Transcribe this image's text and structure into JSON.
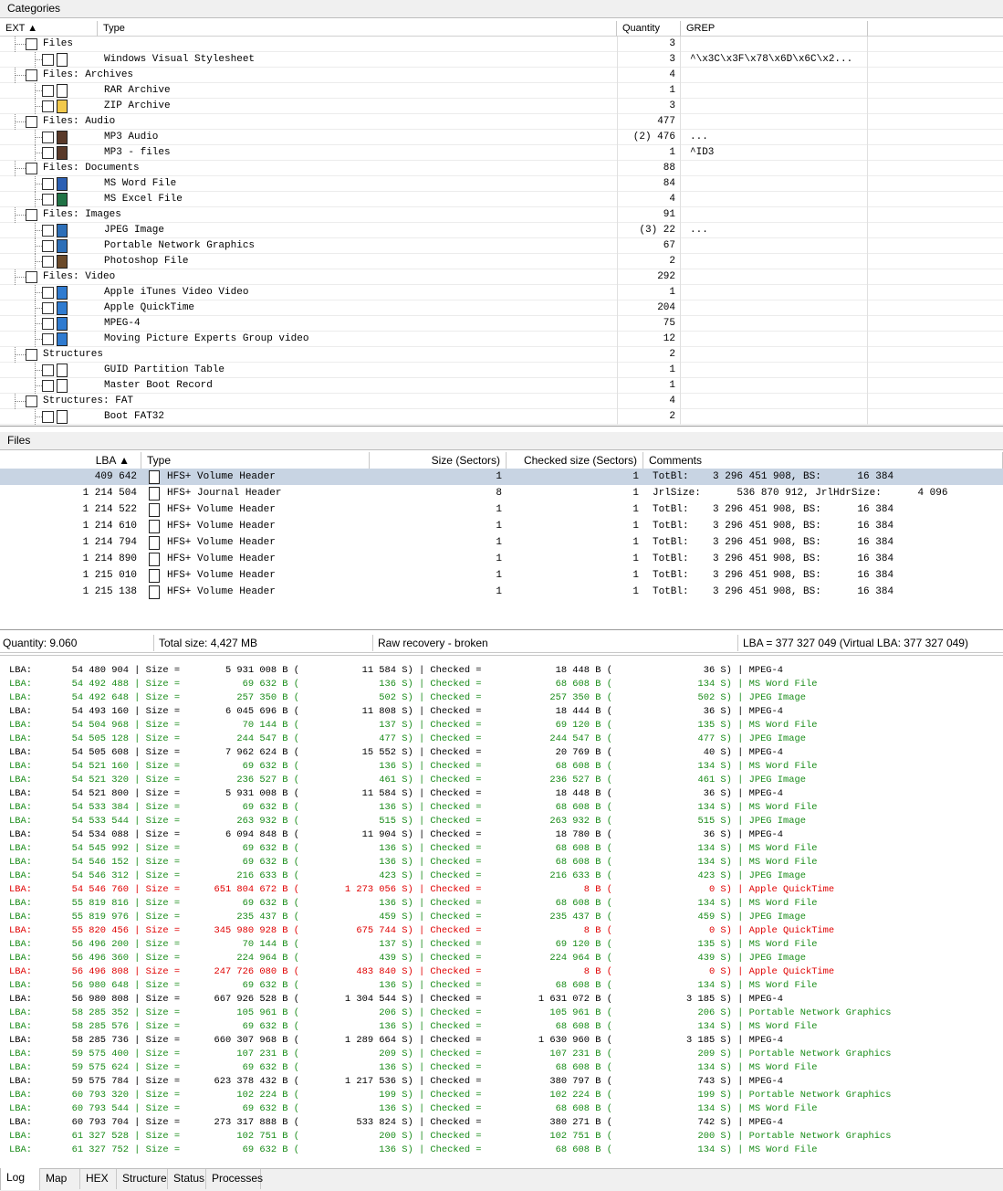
{
  "categories": {
    "title": "Categories",
    "columns": {
      "ext": "EXT",
      "type": "Type",
      "quantity": "Quantity",
      "grep": "GREP"
    },
    "rows": [
      {
        "level": 0,
        "label": "Files",
        "qty": "3",
        "grep": ""
      },
      {
        "level": 1,
        "label": "Windows Visual Stylesheet",
        "qty": "3",
        "grep": "^\\x3C\\x3F\\x78\\x6D\\x6C\\x2...",
        "icon": "blank-file-icon"
      },
      {
        "level": 0,
        "label": "Files: Archives",
        "qty": "4",
        "grep": ""
      },
      {
        "level": 1,
        "label": "RAR Archive",
        "qty": "1",
        "grep": "",
        "icon": "blank-file-icon"
      },
      {
        "level": 1,
        "label": "ZIP Archive",
        "qty": "3",
        "grep": "",
        "icon": "zip-file-icon"
      },
      {
        "level": 0,
        "label": "Files: Audio",
        "qty": "477",
        "grep": ""
      },
      {
        "level": 1,
        "label": "MP3 Audio",
        "qty": "(2) 476",
        "grep": "...",
        "icon": "audio-file-icon"
      },
      {
        "level": 1,
        "label": "MP3 - files",
        "qty": "1",
        "grep": "^ID3",
        "icon": "audio-file-icon"
      },
      {
        "level": 0,
        "label": "Files: Documents",
        "qty": "88",
        "grep": ""
      },
      {
        "level": 1,
        "label": "MS Word File",
        "qty": "84",
        "grep": "",
        "icon": "word-file-icon"
      },
      {
        "level": 1,
        "label": "MS Excel File",
        "qty": "4",
        "grep": "",
        "icon": "excel-file-icon"
      },
      {
        "level": 0,
        "label": "Files: Images",
        "qty": "91",
        "grep": ""
      },
      {
        "level": 1,
        "label": "JPEG Image",
        "qty": "(3) 22",
        "grep": "...",
        "icon": "image-file-icon"
      },
      {
        "level": 1,
        "label": "Portable Network Graphics",
        "qty": "67",
        "grep": "",
        "icon": "image-file-icon"
      },
      {
        "level": 1,
        "label": "Photoshop File",
        "qty": "2",
        "grep": "",
        "icon": "photoshop-file-icon"
      },
      {
        "level": 0,
        "label": "Files: Video",
        "qty": "292",
        "grep": ""
      },
      {
        "level": 1,
        "label": "Apple iTunes Video Video",
        "qty": "1",
        "grep": "",
        "icon": "video-file-icon"
      },
      {
        "level": 1,
        "label": "Apple QuickTime",
        "qty": "204",
        "grep": "",
        "icon": "video-file-icon"
      },
      {
        "level": 1,
        "label": "MPEG-4",
        "qty": "75",
        "grep": "",
        "icon": "video-file-icon"
      },
      {
        "level": 1,
        "label": "Moving Picture Experts Group video",
        "qty": "12",
        "grep": "",
        "icon": "video-file-icon"
      },
      {
        "level": 0,
        "label": "Structures",
        "qty": "2",
        "grep": ""
      },
      {
        "level": 1,
        "label": "GUID Partition Table",
        "qty": "1",
        "grep": "",
        "icon": "blank-file-icon"
      },
      {
        "level": 1,
        "label": "Master Boot Record",
        "qty": "1",
        "grep": "",
        "icon": "blank-file-icon"
      },
      {
        "level": 0,
        "label": "Structures: FAT",
        "qty": "4",
        "grep": ""
      },
      {
        "level": 1,
        "label": "Boot FAT32",
        "qty": "2",
        "grep": "",
        "icon": "blank-file-icon"
      }
    ]
  },
  "files": {
    "title": "Files",
    "columns": {
      "lba": "LBA",
      "type": "Type",
      "size": "Size (Sectors)",
      "checked": "Checked size (Sectors)",
      "comments": "Comments"
    },
    "rows": [
      {
        "lba": "409 642",
        "type": "HFS+ Volume Header",
        "size": "1",
        "checked": "1",
        "comments": "TotBl:    3 296 451 908, BS:      16 384",
        "selected": true
      },
      {
        "lba": "1 214 504",
        "type": "HFS+ Journal Header",
        "size": "8",
        "checked": "1",
        "comments": "JrlSize:      536 870 912, JrlHdrSize:      4 096"
      },
      {
        "lba": "1 214 522",
        "type": "HFS+ Volume Header",
        "size": "1",
        "checked": "1",
        "comments": "TotBl:    3 296 451 908, BS:      16 384"
      },
      {
        "lba": "1 214 610",
        "type": "HFS+ Volume Header",
        "size": "1",
        "checked": "1",
        "comments": "TotBl:    3 296 451 908, BS:      16 384"
      },
      {
        "lba": "1 214 794",
        "type": "HFS+ Volume Header",
        "size": "1",
        "checked": "1",
        "comments": "TotBl:    3 296 451 908, BS:      16 384"
      },
      {
        "lba": "1 214 890",
        "type": "HFS+ Volume Header",
        "size": "1",
        "checked": "1",
        "comments": "TotBl:    3 296 451 908, BS:      16 384"
      },
      {
        "lba": "1 215 010",
        "type": "HFS+ Volume Header",
        "size": "1",
        "checked": "1",
        "comments": "TotBl:    3 296 451 908, BS:      16 384"
      },
      {
        "lba": "1 215 138",
        "type": "HFS+ Volume Header",
        "size": "1",
        "checked": "1",
        "comments": "TotBl:    3 296 451 908, BS:      16 384"
      }
    ]
  },
  "status": {
    "quantity": "Quantity: 9.060",
    "total_size": "Total size: 4,427 MB",
    "mode": "Raw recovery - broken",
    "lba": "LBA = 377 327 049 (Virtual LBA: 377 327 049)"
  },
  "log": {
    "rows": [
      {
        "c": "black",
        "lba": "54 480 904",
        "size": "5 931 008",
        "sectors": "11 584",
        "checked": "18 448",
        "csec": "36",
        "type": "MPEG-4"
      },
      {
        "c": "green",
        "lba": "54 492 488",
        "size": "69 632",
        "sectors": "136",
        "checked": "68 608",
        "csec": "134",
        "type": "MS Word File"
      },
      {
        "c": "green",
        "lba": "54 492 648",
        "size": "257 350",
        "sectors": "502",
        "checked": "257 350",
        "csec": "502",
        "type": "JPEG Image"
      },
      {
        "c": "black",
        "lba": "54 493 160",
        "size": "6 045 696",
        "sectors": "11 808",
        "checked": "18 444",
        "csec": "36",
        "type": "MPEG-4"
      },
      {
        "c": "green",
        "lba": "54 504 968",
        "size": "70 144",
        "sectors": "137",
        "checked": "69 120",
        "csec": "135",
        "type": "MS Word File"
      },
      {
        "c": "green",
        "lba": "54 505 128",
        "size": "244 547",
        "sectors": "477",
        "checked": "244 547",
        "csec": "477",
        "type": "JPEG Image"
      },
      {
        "c": "black",
        "lba": "54 505 608",
        "size": "7 962 624",
        "sectors": "15 552",
        "checked": "20 769",
        "csec": "40",
        "type": "MPEG-4"
      },
      {
        "c": "green",
        "lba": "54 521 160",
        "size": "69 632",
        "sectors": "136",
        "checked": "68 608",
        "csec": "134",
        "type": "MS Word File"
      },
      {
        "c": "green",
        "lba": "54 521 320",
        "size": "236 527",
        "sectors": "461",
        "checked": "236 527",
        "csec": "461",
        "type": "JPEG Image"
      },
      {
        "c": "black",
        "lba": "54 521 800",
        "size": "5 931 008",
        "sectors": "11 584",
        "checked": "18 448",
        "csec": "36",
        "type": "MPEG-4"
      },
      {
        "c": "green",
        "lba": "54 533 384",
        "size": "69 632",
        "sectors": "136",
        "checked": "68 608",
        "csec": "134",
        "type": "MS Word File"
      },
      {
        "c": "green",
        "lba": "54 533 544",
        "size": "263 932",
        "sectors": "515",
        "checked": "263 932",
        "csec": "515",
        "type": "JPEG Image"
      },
      {
        "c": "black",
        "lba": "54 534 088",
        "size": "6 094 848",
        "sectors": "11 904",
        "checked": "18 780",
        "csec": "36",
        "type": "MPEG-4"
      },
      {
        "c": "green",
        "lba": "54 545 992",
        "size": "69 632",
        "sectors": "136",
        "checked": "68 608",
        "csec": "134",
        "type": "MS Word File"
      },
      {
        "c": "green",
        "lba": "54 546 152",
        "size": "69 632",
        "sectors": "136",
        "checked": "68 608",
        "csec": "134",
        "type": "MS Word File"
      },
      {
        "c": "green",
        "lba": "54 546 312",
        "size": "216 633",
        "sectors": "423",
        "checked": "216 633",
        "csec": "423",
        "type": "JPEG Image"
      },
      {
        "c": "red",
        "lba": "54 546 760",
        "size": "651 804 672",
        "sectors": "1 273 056",
        "checked": "8",
        "csec": "0",
        "type": "Apple QuickTime"
      },
      {
        "c": "green",
        "lba": "55 819 816",
        "size": "69 632",
        "sectors": "136",
        "checked": "68 608",
        "csec": "134",
        "type": "MS Word File"
      },
      {
        "c": "green",
        "lba": "55 819 976",
        "size": "235 437",
        "sectors": "459",
        "checked": "235 437",
        "csec": "459",
        "type": "JPEG Image"
      },
      {
        "c": "red",
        "lba": "55 820 456",
        "size": "345 980 928",
        "sectors": "675 744",
        "checked": "8",
        "csec": "0",
        "type": "Apple QuickTime"
      },
      {
        "c": "green",
        "lba": "56 496 200",
        "size": "70 144",
        "sectors": "137",
        "checked": "69 120",
        "csec": "135",
        "type": "MS Word File"
      },
      {
        "c": "green",
        "lba": "56 496 360",
        "size": "224 964",
        "sectors": "439",
        "checked": "224 964",
        "csec": "439",
        "type": "JPEG Image"
      },
      {
        "c": "red",
        "lba": "56 496 808",
        "size": "247 726 080",
        "sectors": "483 840",
        "checked": "8",
        "csec": "0",
        "type": "Apple QuickTime"
      },
      {
        "c": "green",
        "lba": "56 980 648",
        "size": "69 632",
        "sectors": "136",
        "checked": "68 608",
        "csec": "134",
        "type": "MS Word File"
      },
      {
        "c": "black",
        "lba": "56 980 808",
        "size": "667 926 528",
        "sectors": "1 304 544",
        "checked": "1 631 072",
        "csec": "3 185",
        "type": "MPEG-4"
      },
      {
        "c": "green",
        "lba": "58 285 352",
        "size": "105 961",
        "sectors": "206",
        "checked": "105 961",
        "csec": "206",
        "type": "Portable Network Graphics"
      },
      {
        "c": "green",
        "lba": "58 285 576",
        "size": "69 632",
        "sectors": "136",
        "checked": "68 608",
        "csec": "134",
        "type": "MS Word File"
      },
      {
        "c": "black",
        "lba": "58 285 736",
        "size": "660 307 968",
        "sectors": "1 289 664",
        "checked": "1 630 960",
        "csec": "3 185",
        "type": "MPEG-4"
      },
      {
        "c": "green",
        "lba": "59 575 400",
        "size": "107 231",
        "sectors": "209",
        "checked": "107 231",
        "csec": "209",
        "type": "Portable Network Graphics"
      },
      {
        "c": "green",
        "lba": "59 575 624",
        "size": "69 632",
        "sectors": "136",
        "checked": "68 608",
        "csec": "134",
        "type": "MS Word File"
      },
      {
        "c": "black",
        "lba": "59 575 784",
        "size": "623 378 432",
        "sectors": "1 217 536",
        "checked": "380 797",
        "csec": "743",
        "type": "MPEG-4"
      },
      {
        "c": "green",
        "lba": "60 793 320",
        "size": "102 224",
        "sectors": "199",
        "checked": "102 224",
        "csec": "199",
        "type": "Portable Network Graphics"
      },
      {
        "c": "green",
        "lba": "60 793 544",
        "size": "69 632",
        "sectors": "136",
        "checked": "68 608",
        "csec": "134",
        "type": "MS Word File"
      },
      {
        "c": "black",
        "lba": "60 793 704",
        "size": "273 317 888",
        "sectors": "533 824",
        "checked": "380 271",
        "csec": "742",
        "type": "MPEG-4"
      },
      {
        "c": "green",
        "lba": "61 327 528",
        "size": "102 751",
        "sectors": "200",
        "checked": "102 751",
        "csec": "200",
        "type": "Portable Network Graphics"
      },
      {
        "c": "green",
        "lba": "61 327 752",
        "size": "69 632",
        "sectors": "136",
        "checked": "68 608",
        "csec": "134",
        "type": "MS Word File"
      }
    ]
  },
  "tabs": [
    "Log",
    "Map",
    "HEX",
    "Structure",
    "Status",
    "Processes"
  ],
  "colors": {
    "green": "#1a8c1a",
    "red": "#e00000",
    "selected_row": "#c8d4e3"
  }
}
